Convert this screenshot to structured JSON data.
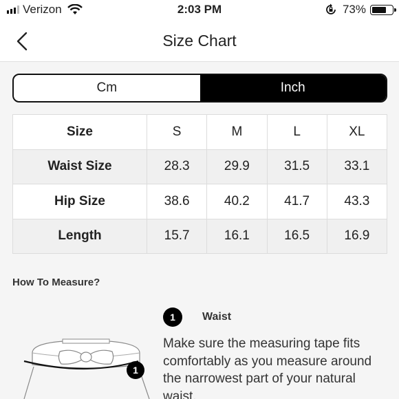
{
  "status_bar": {
    "carrier": "Verizon",
    "time": "2:03 PM",
    "battery_percent": "73%",
    "battery_level": 0.73
  },
  "nav": {
    "title": "Size Chart",
    "back_icon": "chevron-left-icon"
  },
  "unit_toggle": {
    "options": [
      {
        "label": "Cm",
        "active": false
      },
      {
        "label": "Inch",
        "active": true
      }
    ]
  },
  "table": {
    "header": [
      "Size",
      "S",
      "M",
      "L",
      "XL"
    ],
    "rows": [
      {
        "label": "Waist Size",
        "values": [
          "28.3",
          "29.9",
          "31.5",
          "33.1"
        ]
      },
      {
        "label": "Hip Size",
        "values": [
          "38.6",
          "40.2",
          "41.7",
          "43.3"
        ]
      },
      {
        "label": "Length",
        "values": [
          "15.7",
          "16.1",
          "16.5",
          "16.9"
        ]
      }
    ]
  },
  "how_to_measure": {
    "title": "How To Measure?",
    "step": {
      "number": "1",
      "label": "Waist",
      "text": "Make sure the measuring tape fits comfortably as you measure around the narrowest part of your natural waist."
    }
  }
}
